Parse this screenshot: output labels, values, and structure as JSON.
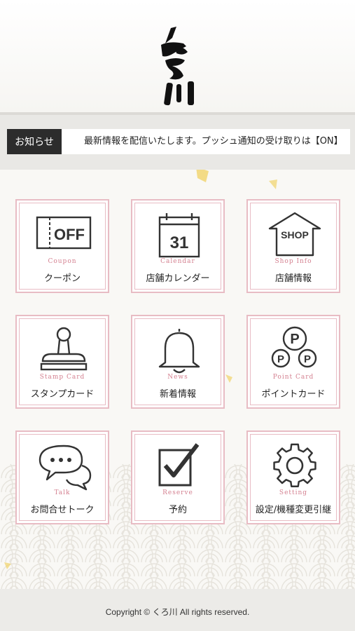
{
  "header": {
    "logo_text": "くろ川"
  },
  "news": {
    "label": "お知らせ",
    "text": "最新情報を配信いたします。プッシュ通知の受け取りは【ON】"
  },
  "menu": [
    {
      "en": "Coupon",
      "jp": "クーポン",
      "icon": "coupon-off-icon",
      "icon_text": "OFF"
    },
    {
      "en": "Calendar",
      "jp": "店舗カレンダー",
      "icon": "calendar-icon",
      "icon_text": "31"
    },
    {
      "en": "Shop Info",
      "jp": "店舗情報",
      "icon": "shop-icon",
      "icon_text": "SHOP"
    },
    {
      "en": "Stamp Card",
      "jp": "スタンプカード",
      "icon": "stamp-icon"
    },
    {
      "en": "News",
      "jp": "新着情報",
      "icon": "bell-icon"
    },
    {
      "en": "Point Card",
      "jp": "ポイントカード",
      "icon": "point-card-icon",
      "icon_text": "P"
    },
    {
      "en": "Talk",
      "jp": "お問合せトーク",
      "icon": "chat-bubbles-icon"
    },
    {
      "en": "Reserve",
      "jp": "予約",
      "icon": "checkbox-icon"
    },
    {
      "en": "Setting",
      "jp": "設定/機種変更引継",
      "icon": "gear-icon"
    }
  ],
  "footer": {
    "copyright": "Copyright © くろ川 All rights reserved."
  },
  "colors": {
    "tile_border": "#e8bcc4",
    "label_en": "#d48090",
    "news_label_bg": "#2c2c2c"
  }
}
